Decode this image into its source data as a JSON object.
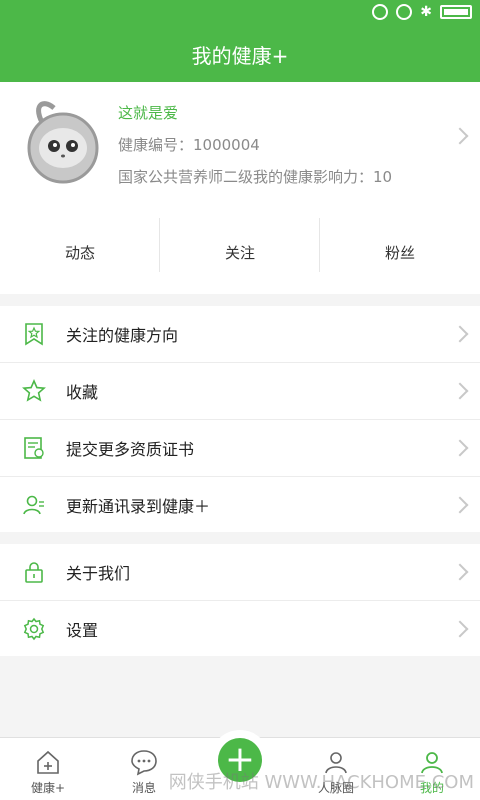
{
  "header": {
    "title": "我的健康+"
  },
  "profile": {
    "name": "这就是爱",
    "id_text": "健康编号：1000004",
    "influence_text": "国家公共营养师二级我的健康影响力：10"
  },
  "stats": [
    {
      "label": "动态"
    },
    {
      "label": "关注"
    },
    {
      "label": "粉丝"
    }
  ],
  "menu_group_1": [
    {
      "label": "关注的健康方向",
      "icon": "bookmark-star-icon"
    },
    {
      "label": "收藏",
      "icon": "star-icon"
    },
    {
      "label": "提交更多资质证书",
      "icon": "certificate-icon"
    },
    {
      "label": "更新通讯录到健康＋",
      "icon": "contacts-icon"
    }
  ],
  "menu_group_2": [
    {
      "label": "关于我们",
      "icon": "lock-icon"
    },
    {
      "label": "设置",
      "icon": "gear-icon"
    }
  ],
  "tabbar": [
    {
      "label": "健康+",
      "icon": "home-icon"
    },
    {
      "label": "消息",
      "icon": "message-icon"
    },
    {
      "label": "",
      "icon": "plus-icon"
    },
    {
      "label": "人脉圈",
      "icon": "people-icon"
    },
    {
      "label": "我的",
      "icon": "me-icon"
    }
  ],
  "watermark": {
    "text": "网侠手机站 WWW.HACKHOME.COM"
  },
  "colors": {
    "accent": "#4cb848"
  }
}
